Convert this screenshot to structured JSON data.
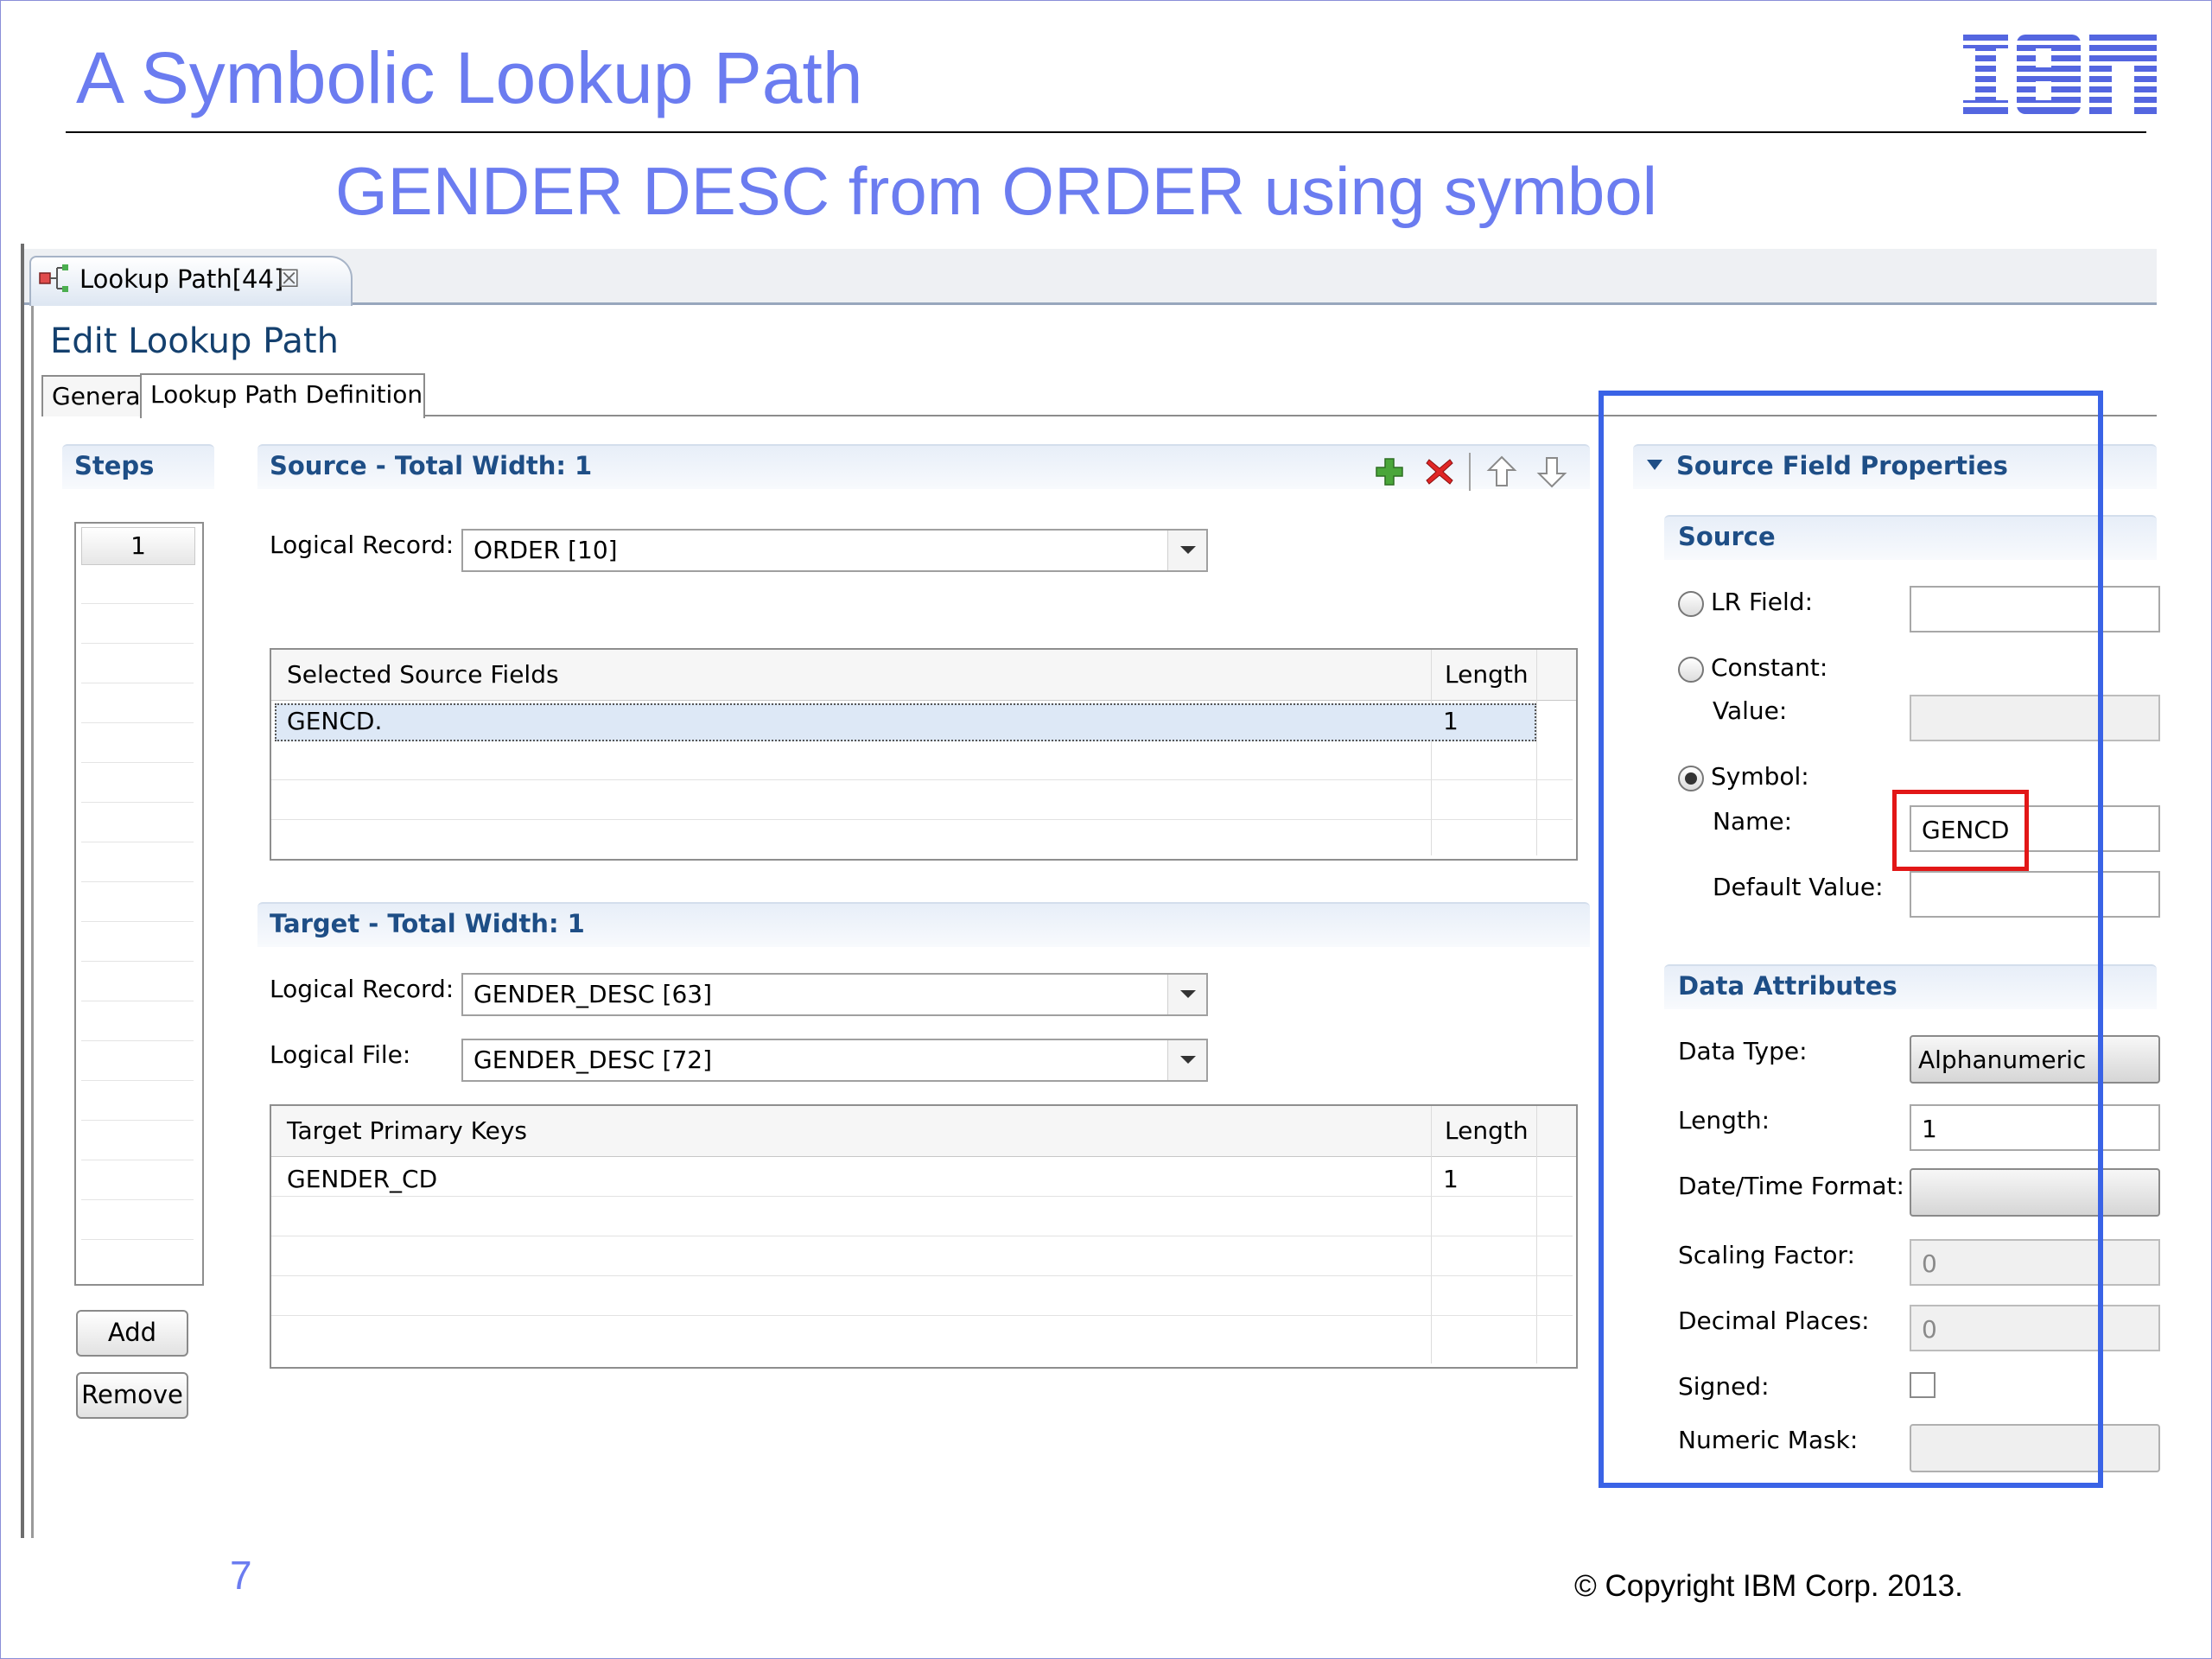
{
  "slide": {
    "title": "A Symbolic Lookup Path",
    "subtitle": "GENDER DESC from ORDER using symbol",
    "logo": "IBM",
    "page_number": "7",
    "copyright": "© Copyright IBM Corp. 2013."
  },
  "editor_tab": {
    "label": "Lookup Path[44]",
    "icon": "lookup-path-icon",
    "close_icon": "close-icon"
  },
  "form": {
    "title": "Edit Lookup Path",
    "tabs": [
      {
        "label": "General"
      },
      {
        "label": "Lookup Path Definition"
      }
    ]
  },
  "steps": {
    "header": "Steps",
    "items": [
      "1"
    ],
    "add_label": "Add",
    "remove_label": "Remove"
  },
  "source": {
    "header": "Source - Total Width: 1",
    "logical_record_label": "Logical Record:",
    "logical_record_value": "ORDER [10]",
    "fields_columns": [
      "Selected Source Fields",
      "Length"
    ],
    "fields_rows": [
      {
        "name": "GENCD.",
        "length": "1"
      }
    ]
  },
  "target": {
    "header": "Target - Total Width: 1",
    "logical_record_label": "Logical Record:",
    "logical_record_value": "GENDER_DESC [63]",
    "logical_file_label": "Logical File:",
    "logical_file_value": "GENDER_DESC [72]",
    "keys_columns": [
      "Target Primary Keys",
      "Length"
    ],
    "keys_rows": [
      {
        "name": "GENDER_CD",
        "length": "1"
      }
    ]
  },
  "properties": {
    "header": "Source Field Properties",
    "source_header": "Source",
    "lr_field_label": "LR Field:",
    "constant_label": "Constant:",
    "value_label": "Value:",
    "symbol_label": "Symbol:",
    "name_label": "Name:",
    "name_value": "GENCD",
    "default_value_label": "Default Value:",
    "selected_source": "Symbol",
    "data_attr_header": "Data Attributes",
    "data_type_label": "Data Type:",
    "data_type_value": "Alphanumeric",
    "length_label": "Length:",
    "length_value": "1",
    "date_format_label": "Date/Time Format:",
    "scaling_label": "Scaling Factor:",
    "scaling_value": "0",
    "decimal_label": "Decimal Places:",
    "decimal_value": "0",
    "signed_label": "Signed:",
    "mask_label": "Numeric Mask:"
  },
  "colors": {
    "title": "#6b7cf0",
    "highlight_box": "#3a63e6",
    "symbol_box": "#e21717",
    "section_header_text": "#1e4e86"
  }
}
